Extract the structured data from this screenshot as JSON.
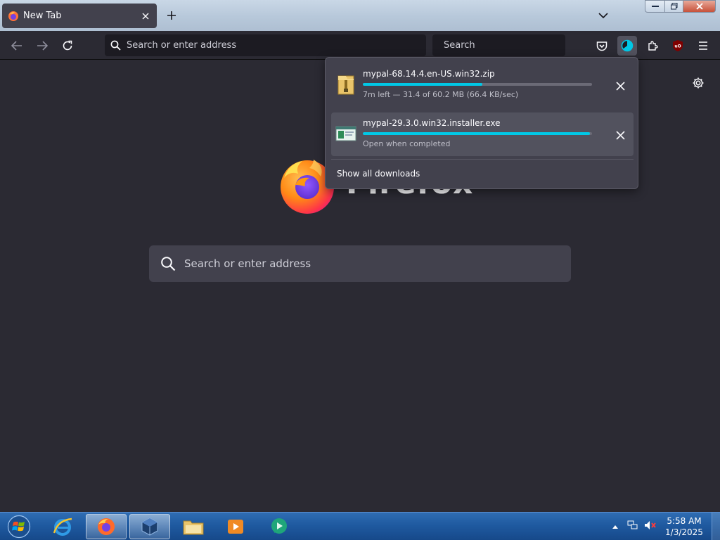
{
  "browser": {
    "tab": {
      "title": "New Tab"
    },
    "urlbar": {
      "placeholder": "Search or enter address"
    },
    "searchbar": {
      "placeholder": "Search"
    }
  },
  "newtab": {
    "wordmark": "Firefox",
    "search": {
      "placeholder": "Search or enter address"
    }
  },
  "downloads": {
    "items": [
      {
        "filename": "mypal-68.14.4.en-US.win32.zip",
        "status": "7m left — 31.4 of 60.2 MB (66.4 KB/sec)",
        "progress": 0.52,
        "icon": "zip-folder-icon"
      },
      {
        "filename": "mypal-29.3.0.win32.installer.exe",
        "status": "Open when completed",
        "progress": 0.99,
        "icon": "installer-icon"
      }
    ],
    "show_all_label": "Show all downloads"
  },
  "colors": {
    "accent": "#00c8e6",
    "toolbar_bg": "#2b2a33",
    "panel_bg": "#42414d"
  },
  "taskbar": {
    "items": [
      "start-orb",
      "internet-explorer",
      "firefox",
      "virtualbox",
      "file-explorer",
      "media-player",
      "messaging-app"
    ],
    "clock": {
      "time": "5:58 AM",
      "date": "1/3/2025"
    }
  }
}
